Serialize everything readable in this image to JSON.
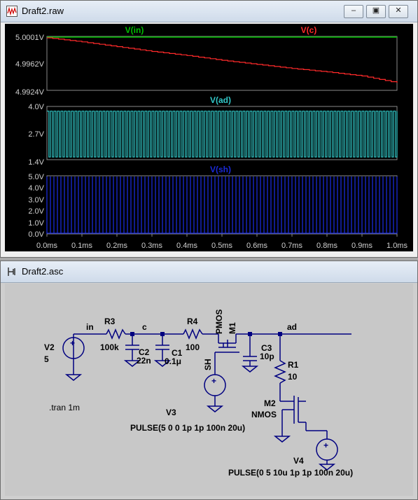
{
  "waveform_window": {
    "title": "Draft2.raw",
    "controls": [
      "minimize",
      "restore",
      "close"
    ],
    "panes": [
      {
        "signals": [
          {
            "name": "V(in)",
            "color": "#00c000"
          },
          {
            "name": "V(c)",
            "color": "#ff2a2a"
          }
        ],
        "y_ticks": [
          "5.0001V",
          "4.9962V",
          "4.9924V"
        ]
      },
      {
        "signals": [
          {
            "name": "V(ad)",
            "color": "#32c8c8"
          }
        ],
        "y_ticks": [
          "4.0V",
          "2.7V",
          "1.4V"
        ]
      },
      {
        "signals": [
          {
            "name": "V(sh)",
            "color": "#1a2ad8"
          }
        ],
        "y_ticks": [
          "5.0V",
          "4.0V",
          "3.0V",
          "2.0V",
          "1.0V",
          "0.0V"
        ]
      }
    ],
    "x_ticks": [
      "0.0ms",
      "0.1ms",
      "0.2ms",
      "0.3ms",
      "0.4ms",
      "0.5ms",
      "0.6ms",
      "0.7ms",
      "0.8ms",
      "0.9ms",
      "1.0ms"
    ]
  },
  "chart_data": [
    {
      "type": "line",
      "series": [
        {
          "name": "V(in)",
          "x": [
            0,
            1.0
          ],
          "y": [
            5.0,
            5.0
          ]
        },
        {
          "name": "V(c)",
          "x": [
            0,
            0.1,
            0.2,
            0.3,
            0.4,
            0.5,
            0.6,
            0.7,
            0.8,
            0.9,
            1.0
          ],
          "y": [
            5.0,
            4.9994,
            4.9987,
            4.998,
            4.9974,
            4.9967,
            4.9961,
            4.9955,
            4.995,
            4.9944,
            4.9934
          ]
        }
      ],
      "xlim": [
        0,
        1.0
      ],
      "ylim": [
        4.9924,
        5.0001
      ]
    },
    {
      "type": "line",
      "series": [
        {
          "name": "V(ad)",
          "period_ms": 0.01,
          "high": 3.8,
          "low": 1.5
        }
      ],
      "xlim": [
        0,
        1.0
      ],
      "ylim": [
        1.4,
        4.0
      ]
    },
    {
      "type": "line",
      "series": [
        {
          "name": "V(sh)",
          "period_ms": 0.01,
          "high": 5.0,
          "low": 0.0
        }
      ],
      "xlim": [
        0,
        1.0
      ],
      "ylim": [
        0.0,
        5.0
      ]
    }
  ],
  "schematic_window": {
    "title": "Draft2.asc",
    "nets": [
      "in",
      "c",
      "ad",
      "SH"
    ],
    "components": {
      "V2": {
        "ref": "V2",
        "value": "5"
      },
      "R3": {
        "ref": "R3",
        "value": "100k"
      },
      "C2": {
        "ref": "C2",
        "value": "22n"
      },
      "C1": {
        "ref": "C1",
        "value": "0.1μ"
      },
      "R4": {
        "ref": "R4",
        "value": "100"
      },
      "M1": {
        "ref": "M1",
        "value": "PMOS"
      },
      "C3": {
        "ref": "C3",
        "value": "10p"
      },
      "R1": {
        "ref": "R1",
        "value": "10"
      },
      "M2": {
        "ref": "M2",
        "value": "NMOS"
      },
      "V3": {
        "ref": "V3",
        "value": "PULSE(5 0 0 1p 1p 100n 20u)"
      },
      "V4": {
        "ref": "V4",
        "value": "PULSE(0 5 10u 1p 1p 100n 20u)"
      }
    },
    "directive": ".tran 1m"
  }
}
